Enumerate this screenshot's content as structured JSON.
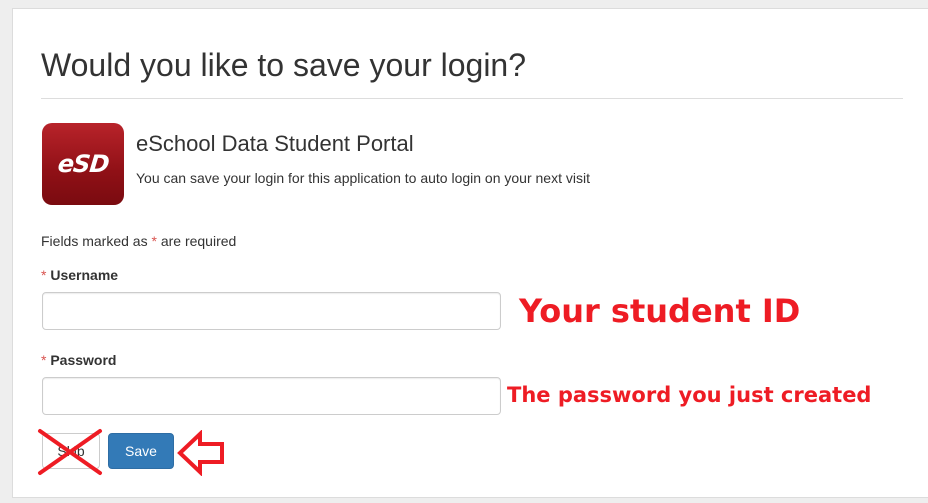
{
  "dialog": {
    "title": "Would you like to save your login?"
  },
  "app": {
    "logo_text": "eSD",
    "name": "eSchool Data Student Portal",
    "description": "You can save your login for this application to auto login on your next visit"
  },
  "form": {
    "required_note_prefix": "Fields marked as ",
    "required_marker": "*",
    "required_note_suffix": " are required",
    "username": {
      "label": "Username",
      "value": "",
      "placeholder": ""
    },
    "password": {
      "label": "Password",
      "value": "",
      "placeholder": ""
    }
  },
  "buttons": {
    "skip_label": "Skip",
    "save_label": "Save"
  },
  "annotations": {
    "username_hint": "Your student ID",
    "password_hint": "The password you just created",
    "color": "#ee1c24"
  },
  "icons": {
    "cross": "red-x-cross-icon",
    "arrow": "red-left-arrow-icon"
  },
  "colors": {
    "logo": "#a8161d",
    "save_button": "#337ab7",
    "required_star": "#d9534f"
  }
}
